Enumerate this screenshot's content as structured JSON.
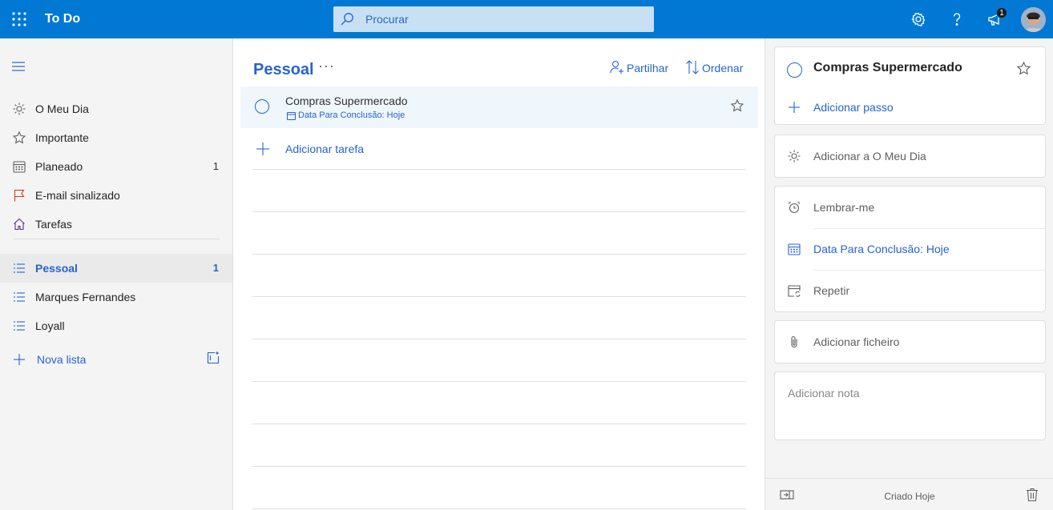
{
  "header": {
    "app_title": "To Do",
    "search_placeholder": "Procurar",
    "notification_count": "1",
    "accent_color": "#0078d4"
  },
  "sidebar": {
    "smart_lists": [
      {
        "label": "O Meu Dia",
        "icon": "sun-icon",
        "count": ""
      },
      {
        "label": "Importante",
        "icon": "star-icon",
        "count": ""
      },
      {
        "label": "Planeado",
        "icon": "calendar-icon",
        "count": "1"
      },
      {
        "label": "E-mail sinalizado",
        "icon": "flag-icon",
        "count": ""
      },
      {
        "label": "Tarefas",
        "icon": "home-icon",
        "count": ""
      }
    ],
    "lists": [
      {
        "label": "Pessoal",
        "count": "1",
        "selected": true
      },
      {
        "label": "Marques Fernandes",
        "count": ""
      },
      {
        "label": "Loyall",
        "count": ""
      }
    ],
    "new_list_label": "Nova lista"
  },
  "main": {
    "list_title": "Pessoal",
    "more_label": "···",
    "share_label": "Partilhar",
    "sort_label": "Ordenar",
    "tasks": [
      {
        "title": "Compras Supermercado",
        "due": "Data Para Conclusão: Hoje",
        "important": false
      }
    ],
    "add_task_label": "Adicionar tarefa"
  },
  "detail": {
    "task_title": "Compras Supermercado",
    "add_step_label": "Adicionar passo",
    "add_my_day_label": "Adicionar a O Meu Dia",
    "remind_label": "Lembrar-me",
    "due_label": "Data Para Conclusão: Hoje",
    "repeat_label": "Repetir",
    "add_file_label": "Adicionar ficheiro",
    "note_placeholder": "Adicionar nota",
    "created_label": "Criado Hoje"
  }
}
